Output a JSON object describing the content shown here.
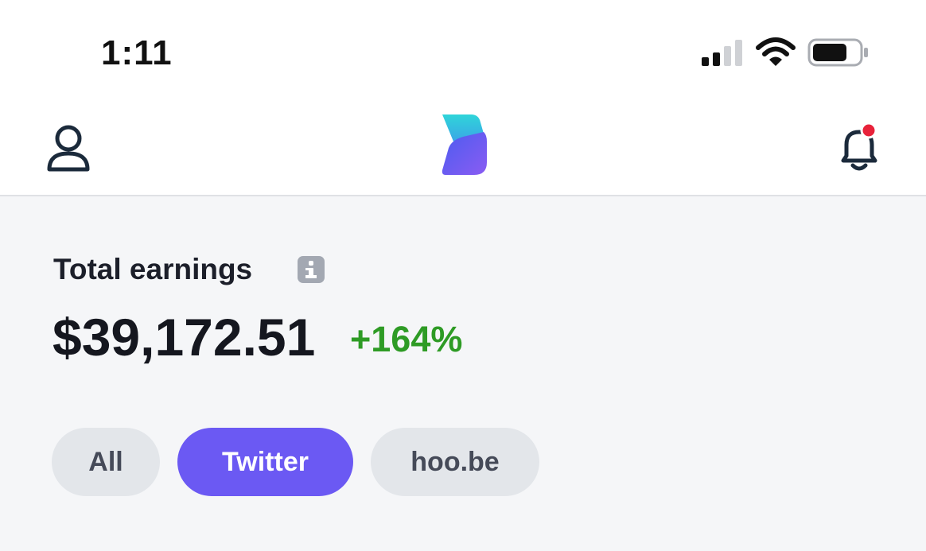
{
  "status_bar": {
    "time": "1:11",
    "signal_icon": "cellular-signal-icon",
    "wifi_icon": "wifi-icon",
    "battery_icon": "battery-icon"
  },
  "header": {
    "profile_icon": "user-profile-icon",
    "logo_icon": "app-logo-icon",
    "notifications_icon": "bell-icon",
    "notification_badge_color": "#e8223a"
  },
  "earnings": {
    "label": "Total earnings",
    "info_icon": "info-icon",
    "amount": "$39,172.51",
    "change": "+164%",
    "change_color": "#2e9b25"
  },
  "filters": {
    "selected": "Twitter",
    "accent_color": "#6b59f3",
    "items": [
      {
        "label": "All"
      },
      {
        "label": "Twitter"
      },
      {
        "label": "hoo.be"
      }
    ]
  }
}
